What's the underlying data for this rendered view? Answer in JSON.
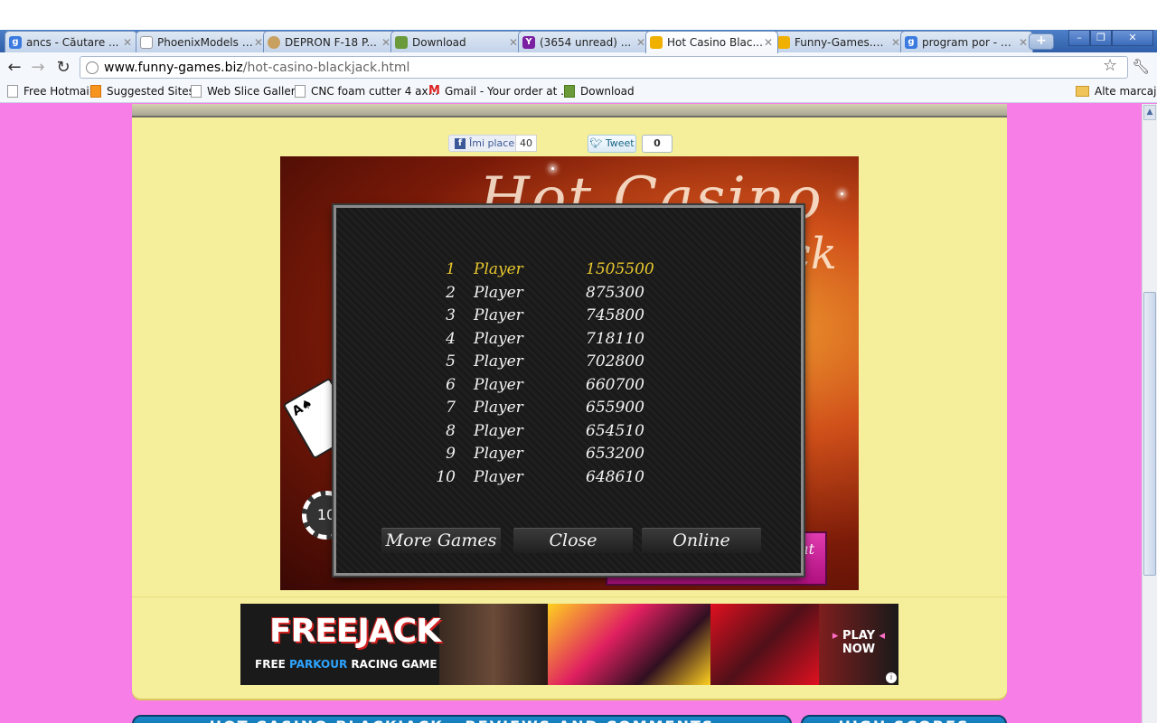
{
  "browser": {
    "tabs": [
      {
        "label": "ancs - Căutare ...",
        "favicon": "google-icon",
        "color": "#3b7be0"
      },
      {
        "label": "PhoenixModels -...",
        "favicon": "page-icon",
        "color": "#ffffff"
      },
      {
        "label": "DEPRON F-18 P...",
        "favicon": "disc-icon",
        "color": "#c8a060"
      },
      {
        "label": "Download",
        "favicon": "download-icon",
        "color": "#6a9a3a"
      },
      {
        "label": "(3654 unread) ...",
        "favicon": "yahoo-icon",
        "color": "#7b1fa2"
      },
      {
        "label": "Hot Casino Blac...",
        "favicon": "funny-games-icon",
        "color": "#f0b000"
      },
      {
        "label": "Funny-Games.bi...",
        "favicon": "funny-games-icon",
        "color": "#f0b000"
      },
      {
        "label": "program por - C...",
        "favicon": "google-icon",
        "color": "#3b7be0"
      }
    ],
    "active_tab_index": 5,
    "url_host": "www.funny-games.biz",
    "url_path": "/hot-casino-blackjack.html",
    "bookmarks": [
      {
        "label": "Free Hotmail",
        "icon": "page-icon"
      },
      {
        "label": "Suggested Sites",
        "icon": "suggested-sites-icon"
      },
      {
        "label": "Web Slice Gallery",
        "icon": "page-icon"
      },
      {
        "label": "CNC foam cutter 4 ax...",
        "icon": "page-icon"
      },
      {
        "label": "Gmail - Your order at ...",
        "icon": "gmail-icon"
      },
      {
        "label": "Download",
        "icon": "download-icon"
      }
    ],
    "other_bookmarks": "Alte marcaje"
  },
  "social": {
    "like_label": "Îmi place",
    "like_count": "40",
    "tweet_label": "Tweet",
    "tweet_count": "0"
  },
  "game": {
    "background_title": "Hot Casino",
    "background_title_tail": "ck",
    "card_label": "A",
    "chip_label": "10",
    "pink_button_text": "at",
    "highscores": [
      {
        "rank": "1",
        "name": "Player",
        "score": "1505500"
      },
      {
        "rank": "2",
        "name": "Player",
        "score": "875300"
      },
      {
        "rank": "3",
        "name": "Player",
        "score": "745800"
      },
      {
        "rank": "4",
        "name": "Player",
        "score": "718110"
      },
      {
        "rank": "5",
        "name": "Player",
        "score": "702800"
      },
      {
        "rank": "6",
        "name": "Player",
        "score": "660700"
      },
      {
        "rank": "7",
        "name": "Player",
        "score": "655900"
      },
      {
        "rank": "8",
        "name": "Player",
        "score": "654510"
      },
      {
        "rank": "9",
        "name": "Player",
        "score": "653200"
      },
      {
        "rank": "10",
        "name": "Player",
        "score": "648610"
      }
    ],
    "buttons": {
      "more_games": "More Games",
      "close": "Close",
      "online": "Online"
    },
    "highlight_color": "#e8c82e"
  },
  "ad": {
    "logo": "FREEJACK",
    "tagline_prefix": "FREE ",
    "tagline_highlight": "PARKOUR",
    "tagline_suffix": " RACING GAME",
    "play_line1": "PLAY",
    "play_line2": "NOW"
  },
  "sections": {
    "reviews_title": "HOT CASINO BLACKJACK - REVIEWS AND COMMENTS",
    "highscores_title": "HIGH SCORES"
  },
  "colors": {
    "page_background": "#f77ee6",
    "panel_background": "#f5ee9a",
    "section_header": "#1a88c9"
  }
}
